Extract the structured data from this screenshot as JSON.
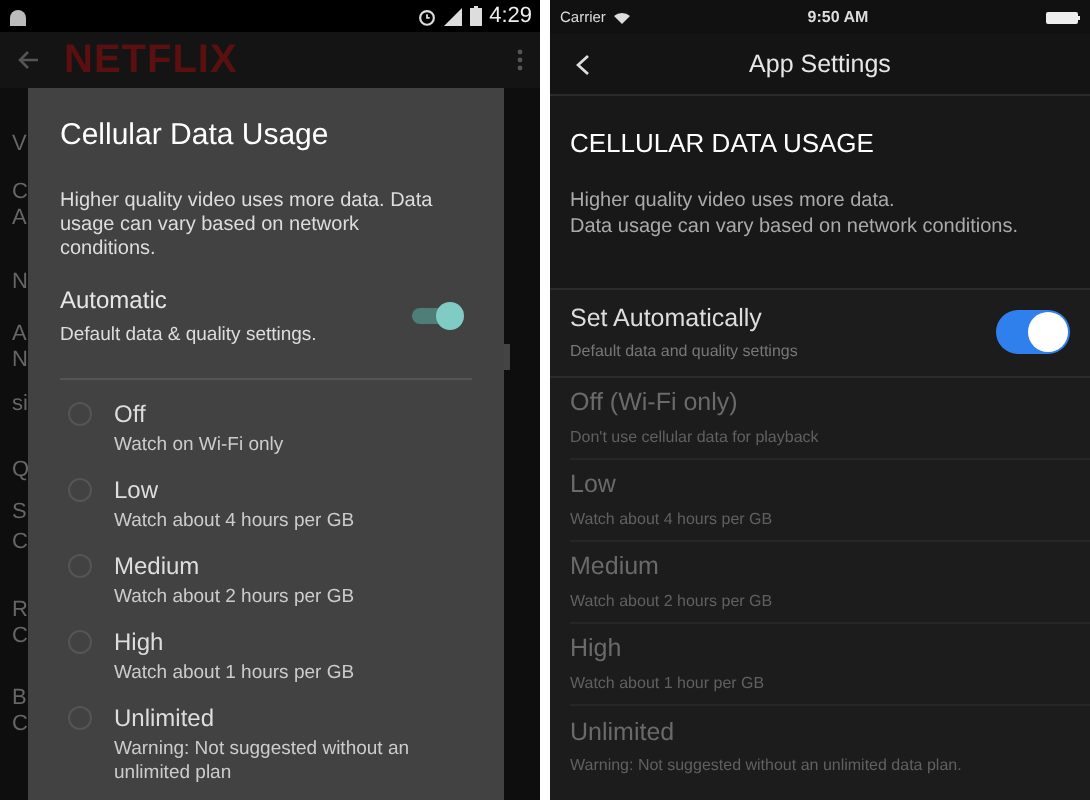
{
  "android": {
    "status_bar": {
      "time": "4:29"
    },
    "toolbar": {
      "logo": "NETFLIX"
    },
    "background_fragments": [
      "V",
      "C",
      "A",
      "N",
      "A",
      "N",
      "si",
      "Q",
      "S",
      "C",
      "R",
      "C",
      "B",
      "C"
    ],
    "dialog": {
      "title": "Cellular Data Usage",
      "description": "Higher quality video uses more data. Data usage can vary based on network conditions.",
      "automatic": {
        "label": "Automatic",
        "sublabel": "Default data & quality settings.",
        "on": true
      },
      "options": [
        {
          "label": "Off",
          "sublabel": "Watch on Wi-Fi only",
          "selected": false
        },
        {
          "label": "Low",
          "sublabel": "Watch about 4 hours per GB",
          "selected": false
        },
        {
          "label": "Medium",
          "sublabel": "Watch about 2 hours per GB",
          "selected": false
        },
        {
          "label": "High",
          "sublabel": "Watch about 1 hours per GB",
          "selected": false
        },
        {
          "label": "Unlimited",
          "sublabel": "Warning: Not suggested without an unlimited plan",
          "selected": false
        }
      ]
    }
  },
  "ios": {
    "status_bar": {
      "carrier": "Carrier",
      "time": "9:50 AM"
    },
    "nav": {
      "title": "App Settings"
    },
    "section_title": "CELLULAR DATA USAGE",
    "description": "Higher quality video uses more data.\nData usage can vary based on network conditions.",
    "automatic": {
      "label": "Set Automatically",
      "sublabel": "Default data and quality settings",
      "on": true
    },
    "options": [
      {
        "label": "Off (Wi-Fi only)",
        "sublabel": "Don't use cellular data for playback",
        "disabled": true
      },
      {
        "label": "Low",
        "sublabel": "Watch about 4 hours per GB",
        "disabled": true
      },
      {
        "label": "Medium",
        "sublabel": "Watch about 2 hours per GB",
        "disabled": true
      },
      {
        "label": "High",
        "sublabel": "Watch about 1 hour per GB",
        "disabled": true
      },
      {
        "label": "Unlimited",
        "sublabel": "Warning: Not suggested without an unlimited data plan.",
        "disabled": true
      }
    ]
  }
}
